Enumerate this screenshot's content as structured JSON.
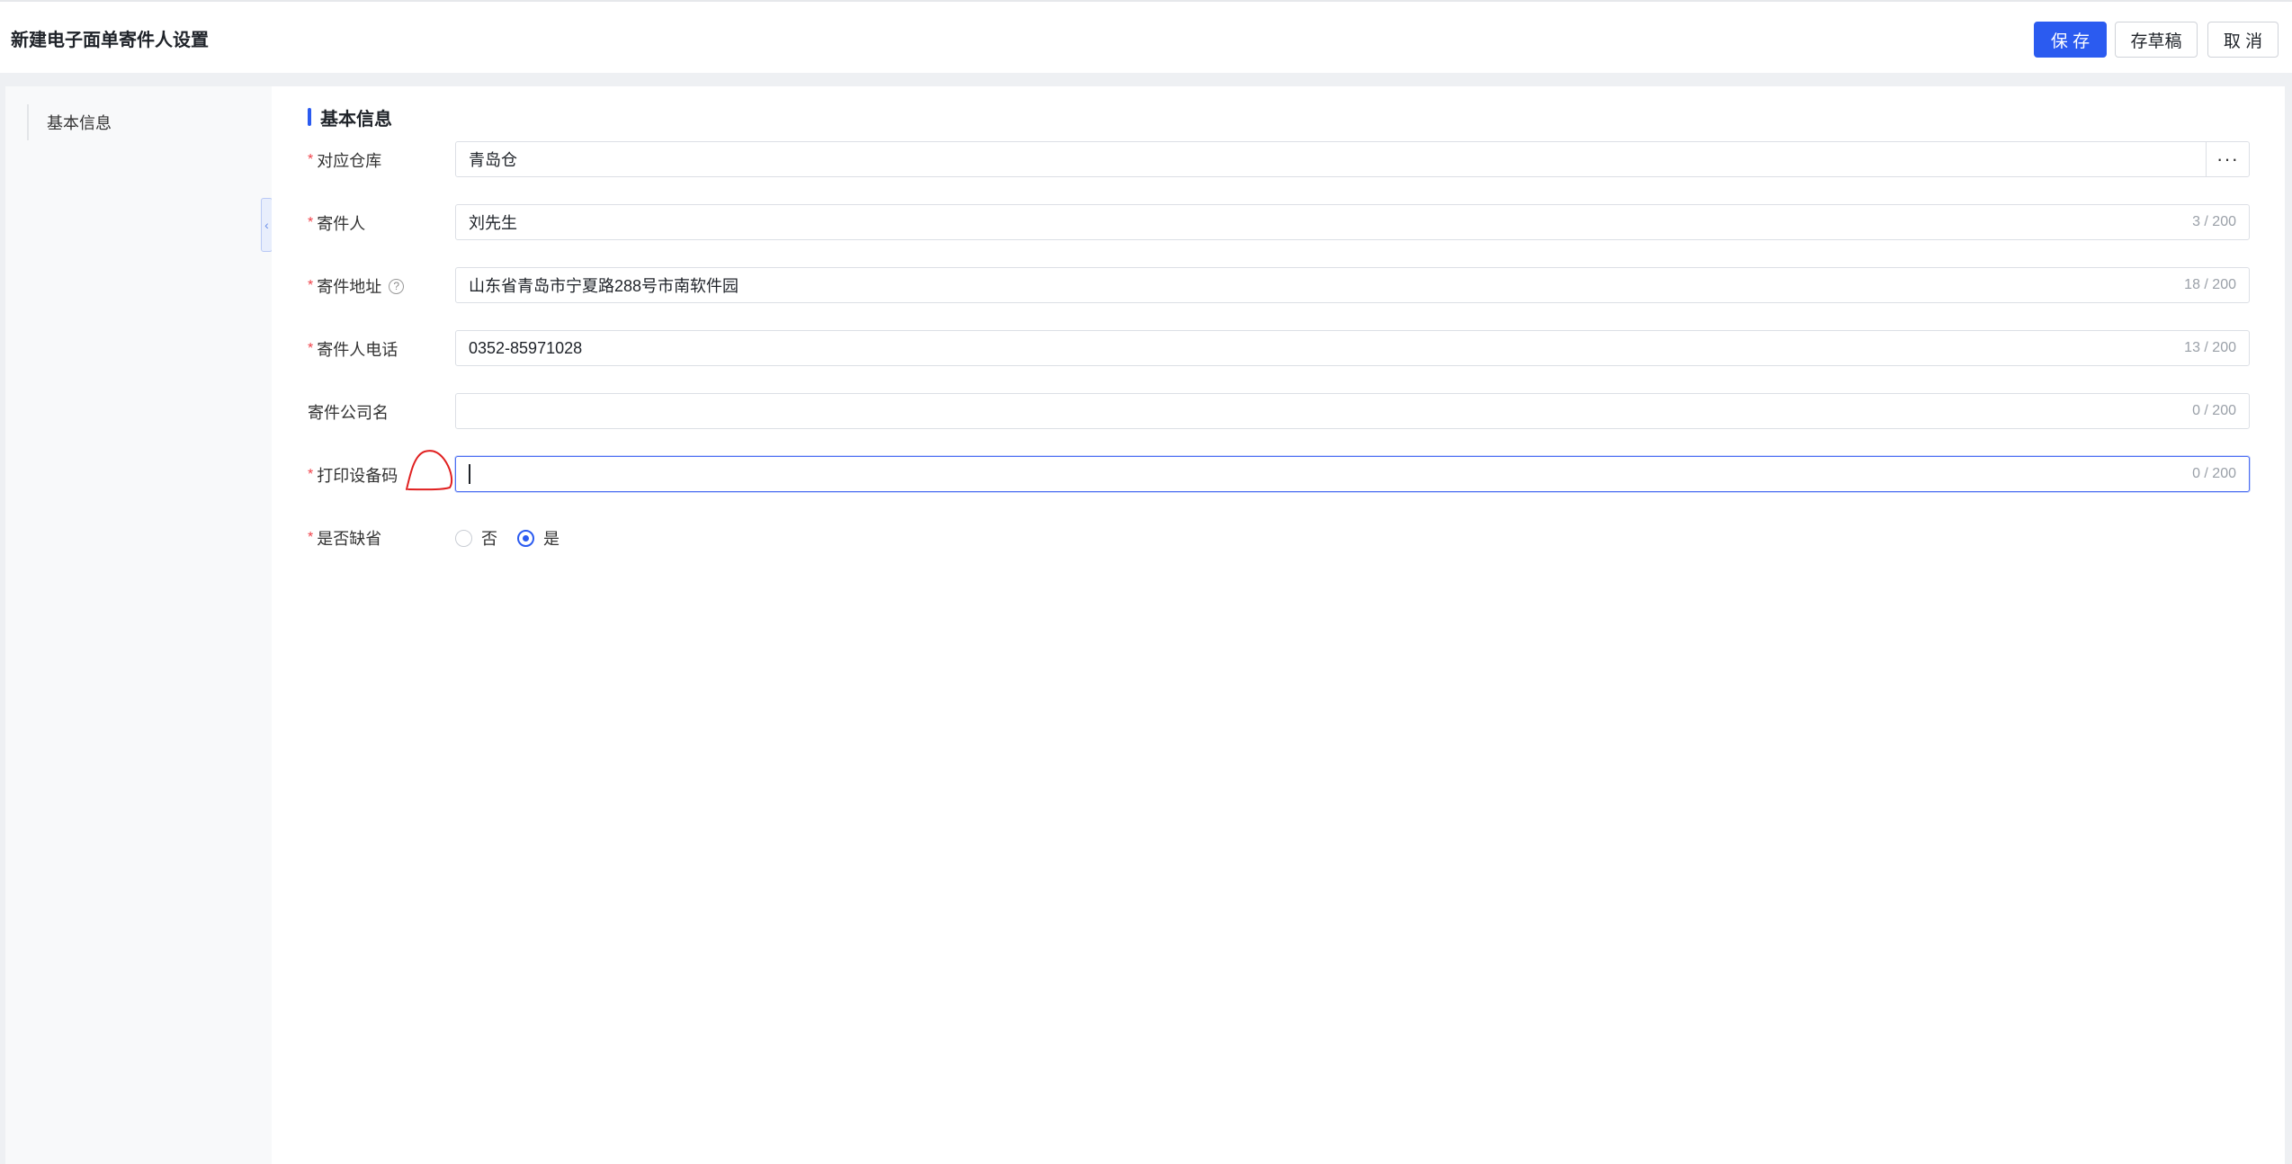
{
  "header": {
    "title": "新建电子面单寄件人设置",
    "buttons": {
      "save": "保 存",
      "draft": "存草稿",
      "cancel": "取 消"
    }
  },
  "sidebar": {
    "items": [
      {
        "label": "基本信息"
      }
    ],
    "collapse_glyph": "‹"
  },
  "form": {
    "section_title": "基本信息",
    "required_mark": "*",
    "fields": {
      "warehouse": {
        "label": "对应仓库",
        "value": "青岛仓",
        "more": "···"
      },
      "sender": {
        "label": "寄件人",
        "value": "刘先生",
        "counter": "3 / 200"
      },
      "address": {
        "label": "寄件地址",
        "help": "?",
        "value": "山东省青岛市宁夏路288号市南软件园",
        "counter": "18 / 200"
      },
      "phone": {
        "label": "寄件人电话",
        "value": "0352-85971028",
        "counter": "13 / 200"
      },
      "company": {
        "label": "寄件公司名",
        "value": "",
        "counter": "0 / 200"
      },
      "device_code": {
        "label": "打印设备码",
        "value": "",
        "counter": "0 / 200"
      },
      "is_default": {
        "label": "是否缺省",
        "options": [
          "否",
          "是"
        ],
        "selected": "是"
      }
    }
  },
  "colors": {
    "primary": "#2b5bf0",
    "required": "#f0424a",
    "annotation": "#e02020"
  }
}
